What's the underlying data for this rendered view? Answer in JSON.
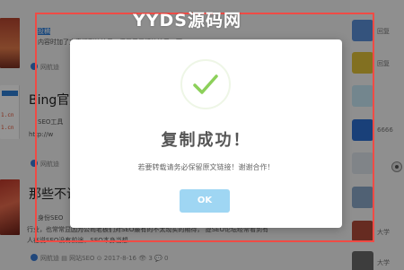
{
  "watermark": {
    "text": "YYDS源码网"
  },
  "modal": {
    "icon": "check-icon",
    "title": "复制成功！",
    "message": "若要转载请务必保留原文链接！谢谢合作！",
    "ok_label": "OK"
  },
  "background": {
    "articles": [
      {
        "title": "",
        "excerpt_lines": [
          "投稿",
          "  内容时加了文章提到的帖子，但是只是们的帖子，而"
        ],
        "meta": "网航迪"
      },
      {
        "title": "Bing官方",
        "excerpt_lines": [
          "SEO工具",
          "http://w"
        ],
        "meta": "网航迪"
      },
      {
        "title": "那些不说",
        "excerpt_lines": [
          "身份SEO",
          "行业，也常常显因为公司老板们对SEO最有的不太现实的期待，    提SEO论坛经常看到有",
          "人在说SEO没有前途，SEO本身当想"
        ],
        "meta": "网航迪    ▤ 网站SEO   ⊙ 2017-8-16   👁 3   💬 0"
      }
    ],
    "sidebar_names": [
      "回复",
      "回复",
      "",
      "6666",
      "",
      "",
      "大学",
      "大学"
    ],
    "thumb_text": [
      "1.cn",
      "1.cn"
    ],
    "colors": {
      "accent": "#2f7ed8",
      "frame": "#f04b45",
      "check": "#8cd05a",
      "ok_button": "#9fd6f3"
    }
  }
}
